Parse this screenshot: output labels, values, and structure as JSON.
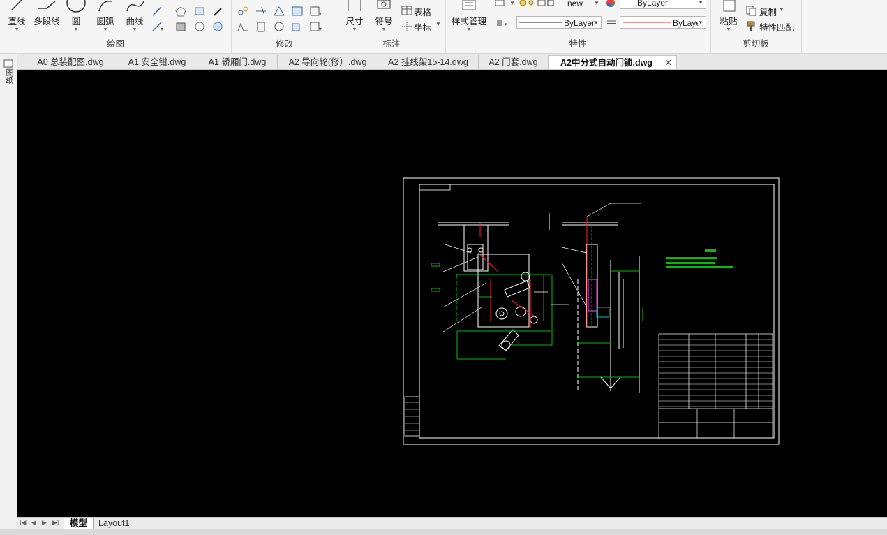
{
  "ribbon": {
    "draw": {
      "title": "绘图",
      "line": "直线",
      "polyline": "多段线",
      "circle": "圆",
      "arc": "圆弧",
      "curve": "曲线"
    },
    "modify": {
      "title": "修改"
    },
    "annotate": {
      "title": "标注",
      "dimension": "尺寸",
      "symbol": "符号",
      "table": "表格",
      "coordinate": "坐标"
    },
    "properties": {
      "title": "特性",
      "style_manager": "样式管理",
      "layer_name": "new",
      "color_value": "ByLayer",
      "linetype_value": "ByLayer",
      "lineweight_value": "ByLayer"
    },
    "clipboard": {
      "title": "剪切板",
      "paste": "粘贴",
      "copy": "复制",
      "match_properties": "特性匹配"
    }
  },
  "tabs": [
    {
      "label": "A0 总装配图.dwg"
    },
    {
      "label": "A1 安全钳.dwg"
    },
    {
      "label": "A1 轿厢门.dwg"
    },
    {
      "label": "A2 导向轮(修）.dwg"
    },
    {
      "label": "A2 挂线架15-14.dwg"
    },
    {
      "label": "A2 门套.dwg"
    },
    {
      "label": "A2中分式自动门锁.dwg",
      "close": "✕"
    }
  ],
  "side_toolbar": {
    "label": "图纸"
  },
  "layout_tabs": [
    {
      "label": "模型"
    },
    {
      "label": "Layout1"
    }
  ],
  "colors": {
    "canvas_bg": "#000000",
    "drawing_white": "#ffffff",
    "drawing_green": "#00c000",
    "drawing_red": "#ff2020",
    "drawing_magenta": "#ff40ff",
    "drawing_cyan": "#00c0c0"
  }
}
